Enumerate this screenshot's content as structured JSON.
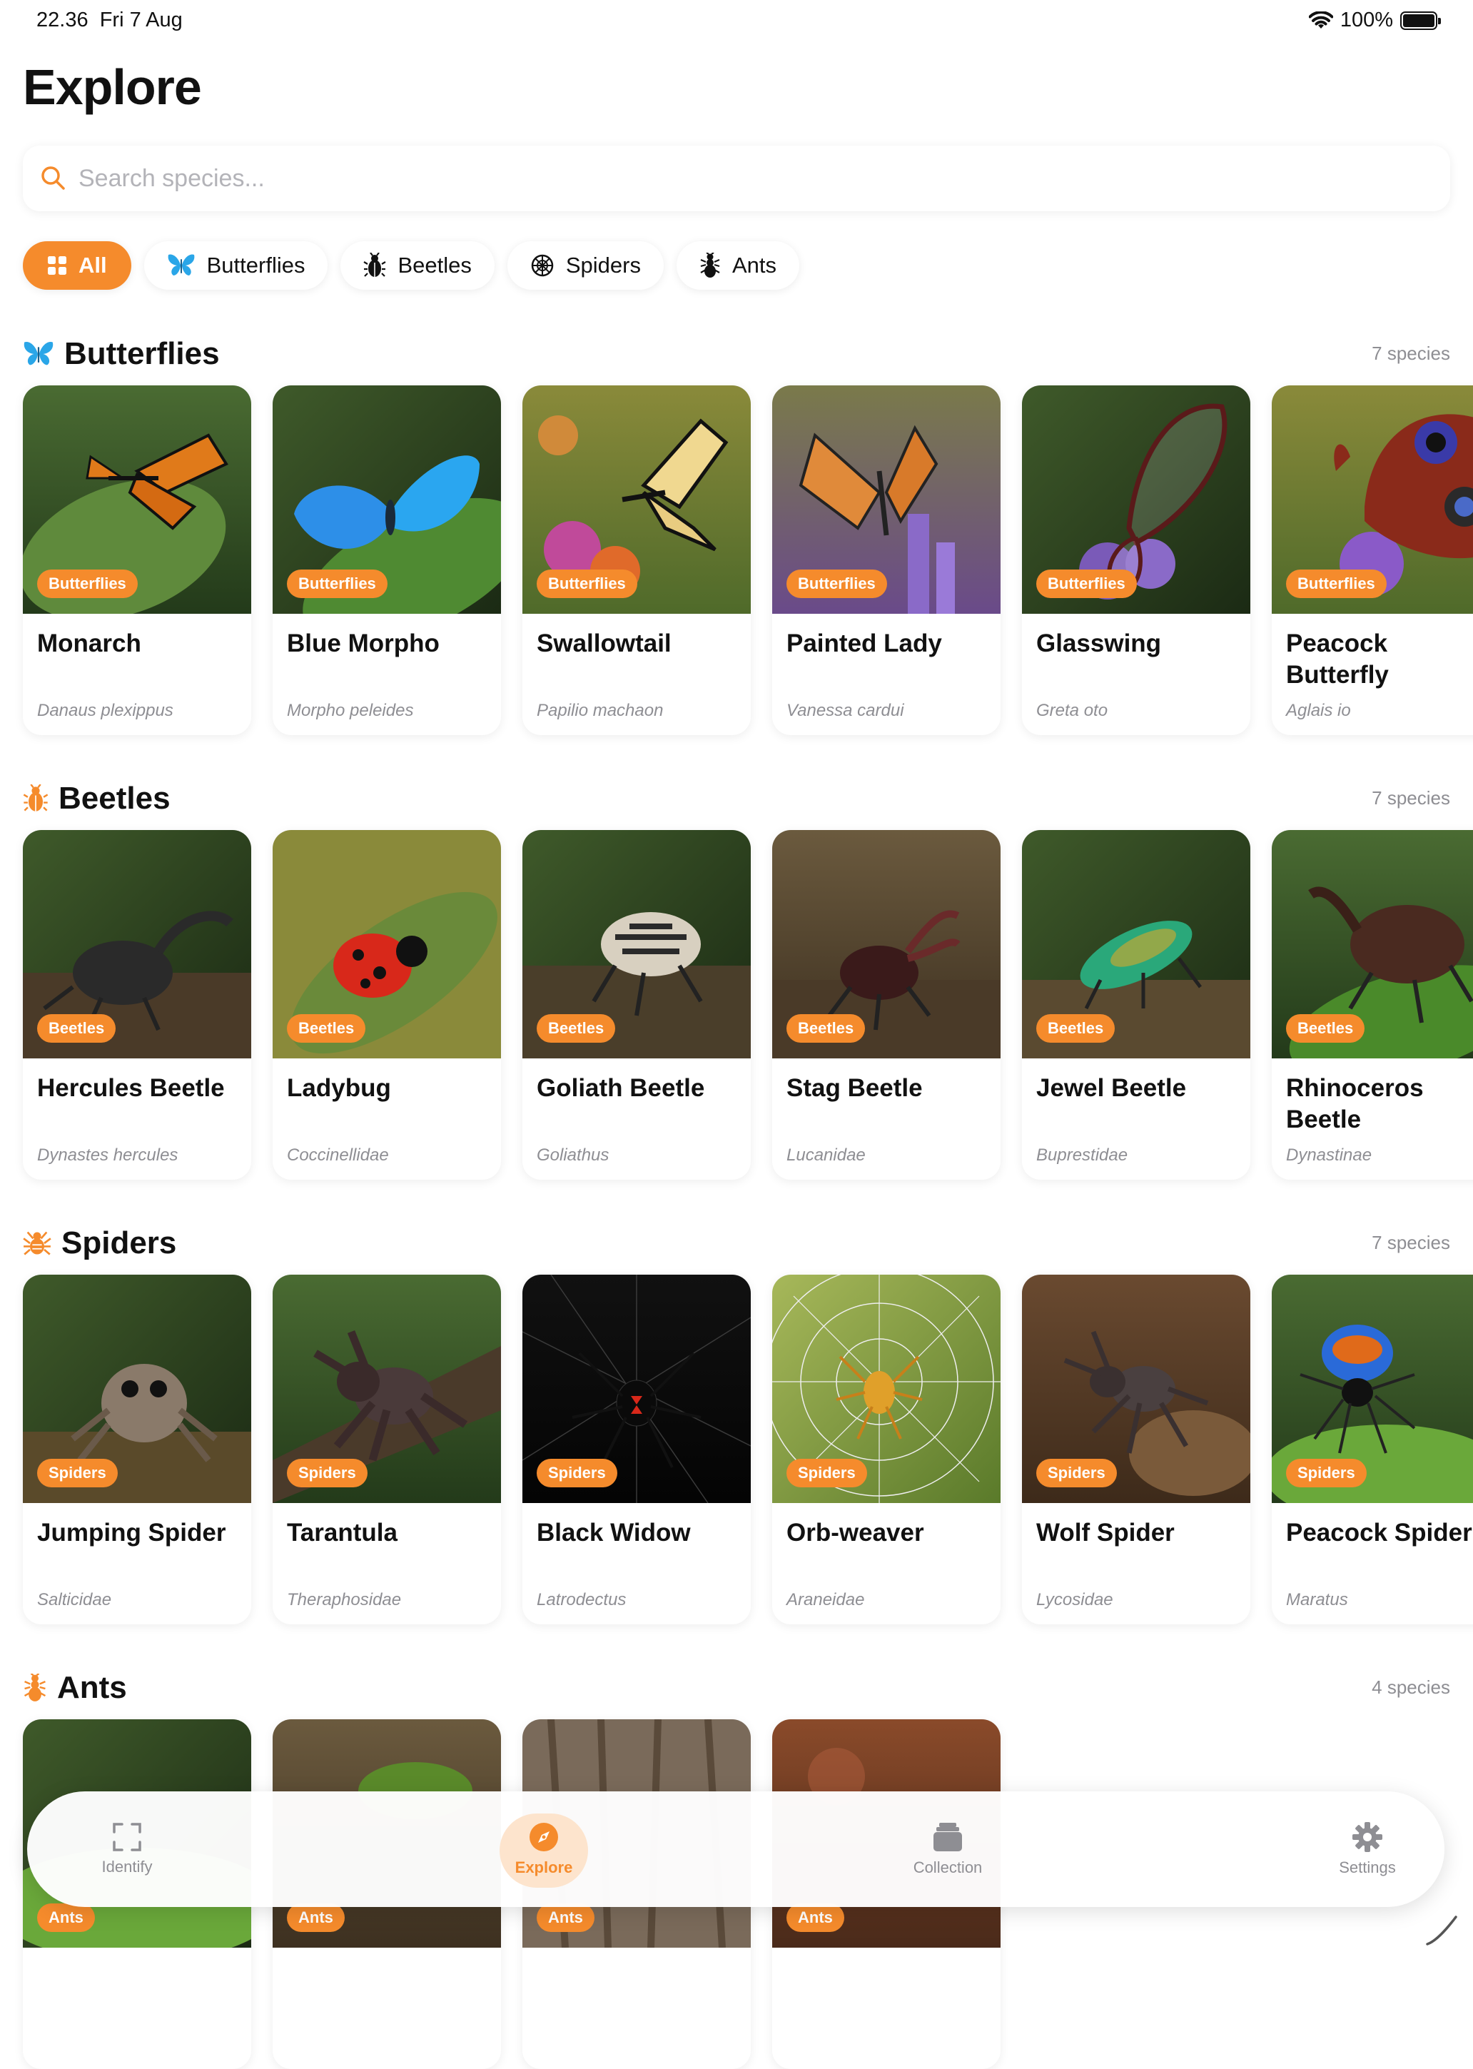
{
  "status_bar": {
    "time": "22.36",
    "date": "Fri 7 Aug",
    "battery": "100%"
  },
  "page_title": "Explore",
  "search": {
    "placeholder": "Search species..."
  },
  "filters": [
    {
      "label": "All",
      "icon": "grid-icon",
      "active": true
    },
    {
      "label": "Butterflies",
      "icon": "butterfly-icon",
      "active": false
    },
    {
      "label": "Beetles",
      "icon": "beetle-icon",
      "active": false
    },
    {
      "label": "Spiders",
      "icon": "spider-icon",
      "active": false
    },
    {
      "label": "Ants",
      "icon": "ant-icon",
      "active": false
    }
  ],
  "sections": [
    {
      "title": "Butterflies",
      "icon": "butterfly-icon",
      "count": "7 species",
      "items": [
        {
          "name": "Monarch",
          "latin": "Danaus plexippus",
          "badge": "Butterflies"
        },
        {
          "name": "Blue Morpho",
          "latin": "Morpho peleides",
          "badge": "Butterflies"
        },
        {
          "name": "Swallowtail",
          "latin": "Papilio machaon",
          "badge": "Butterflies"
        },
        {
          "name": "Painted Lady",
          "latin": "Vanessa cardui",
          "badge": "Butterflies"
        },
        {
          "name": "Glasswing",
          "latin": "Greta oto",
          "badge": "Butterflies"
        },
        {
          "name": "Peacock Butterfly",
          "latin": "Aglais io",
          "badge": "Butterflies"
        }
      ]
    },
    {
      "title": "Beetles",
      "icon": "beetle-icon",
      "count": "7 species",
      "items": [
        {
          "name": "Hercules Beetle",
          "latin": "Dynastes hercules",
          "badge": "Beetles"
        },
        {
          "name": "Ladybug",
          "latin": "Coccinellidae",
          "badge": "Beetles"
        },
        {
          "name": "Goliath Beetle",
          "latin": "Goliathus",
          "badge": "Beetles"
        },
        {
          "name": "Stag Beetle",
          "latin": "Lucanidae",
          "badge": "Beetles"
        },
        {
          "name": "Jewel Beetle",
          "latin": "Buprestidae",
          "badge": "Beetles"
        },
        {
          "name": "Rhinoceros Beetle",
          "latin": "Dynastinae",
          "badge": "Beetles"
        }
      ]
    },
    {
      "title": "Spiders",
      "icon": "spider-icon",
      "count": "7 species",
      "items": [
        {
          "name": "Jumping Spider",
          "latin": "Salticidae",
          "badge": "Spiders"
        },
        {
          "name": "Tarantula",
          "latin": "Theraphosidae",
          "badge": "Spiders"
        },
        {
          "name": "Black Widow",
          "latin": "Latrodectus",
          "badge": "Spiders"
        },
        {
          "name": "Orb-weaver",
          "latin": "Araneidae",
          "badge": "Spiders"
        },
        {
          "name": "Wolf Spider",
          "latin": "Lycosidae",
          "badge": "Spiders"
        },
        {
          "name": "Peacock Spider",
          "latin": "Maratus",
          "badge": "Spiders"
        }
      ]
    },
    {
      "title": "Ants",
      "icon": "ant-icon",
      "count": "4 species",
      "items": [
        {
          "name": "",
          "latin": "",
          "badge": "Ants"
        },
        {
          "name": "",
          "latin": "",
          "badge": "Ants"
        },
        {
          "name": "",
          "latin": "",
          "badge": "Ants"
        },
        {
          "name": "",
          "latin": "",
          "badge": "Ants"
        }
      ]
    }
  ],
  "tab_bar": [
    {
      "label": "Identify",
      "icon": "scan-icon",
      "active": false
    },
    {
      "label": "Explore",
      "icon": "compass-icon",
      "active": true
    },
    {
      "label": "Collection",
      "icon": "stack-icon",
      "active": false
    },
    {
      "label": "Settings",
      "icon": "gear-icon",
      "active": false
    }
  ],
  "colors": {
    "accent": "#f58b2c",
    "accent_soft": "#fde4cd",
    "secondary_text": "#8e8e93",
    "butterfly_icon": "#2aa6e8"
  }
}
